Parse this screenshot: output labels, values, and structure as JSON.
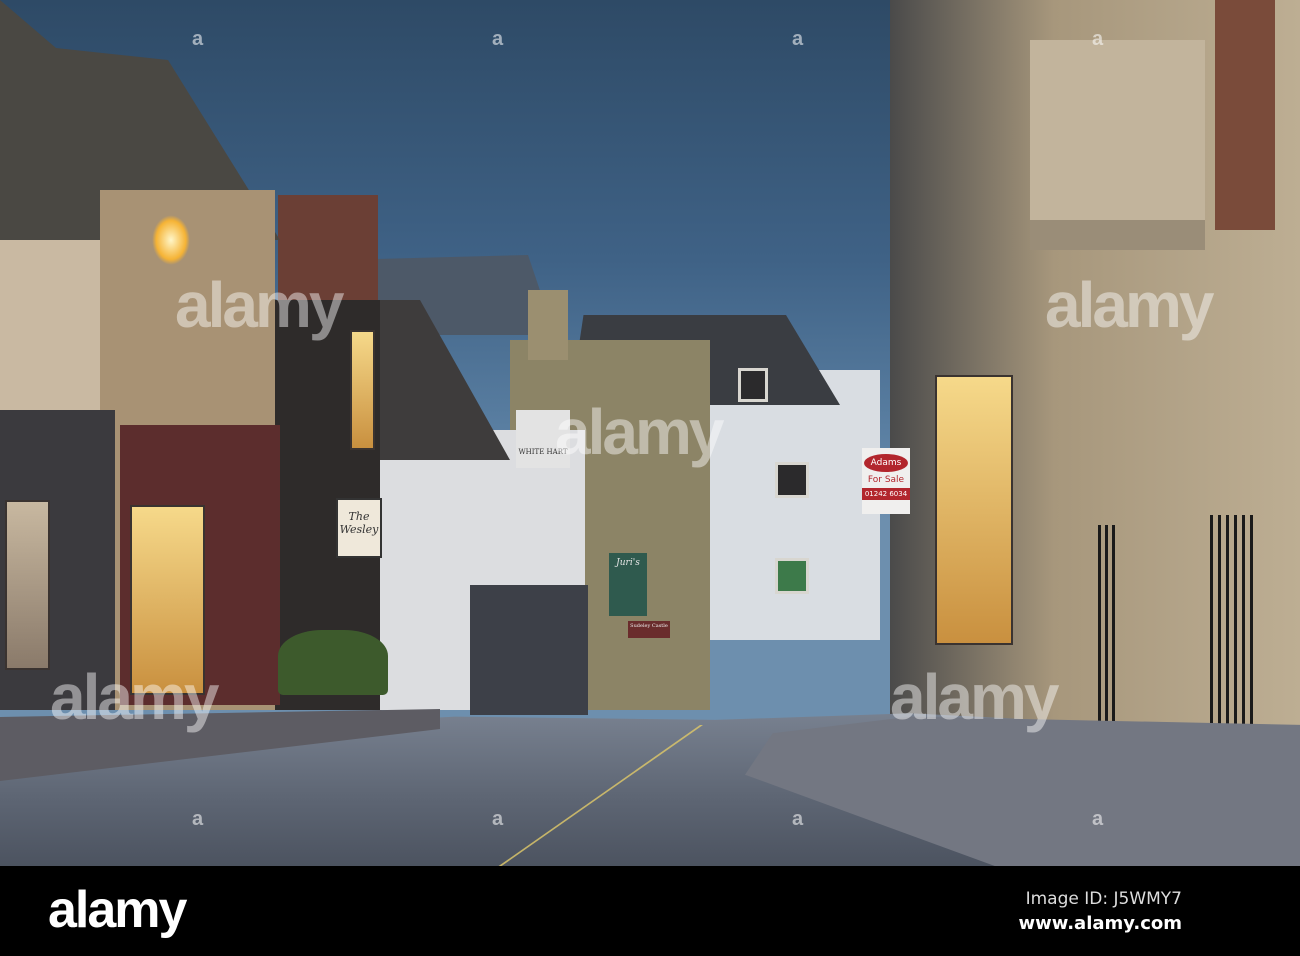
{
  "photo": {
    "signs": {
      "wesley": "The Wesley",
      "white_hart": "WHITE HART",
      "juris": "Juri's",
      "sudeley": "Sudeley Castle",
      "adams": "Adams",
      "for_sale": "For Sale",
      "phone": "01242 6034"
    },
    "watermark": "alamy",
    "watermark_small": "a"
  },
  "footer": {
    "logo": "alamy",
    "image_id": "Image ID: J5WMY7",
    "url": "www.alamy.com"
  }
}
